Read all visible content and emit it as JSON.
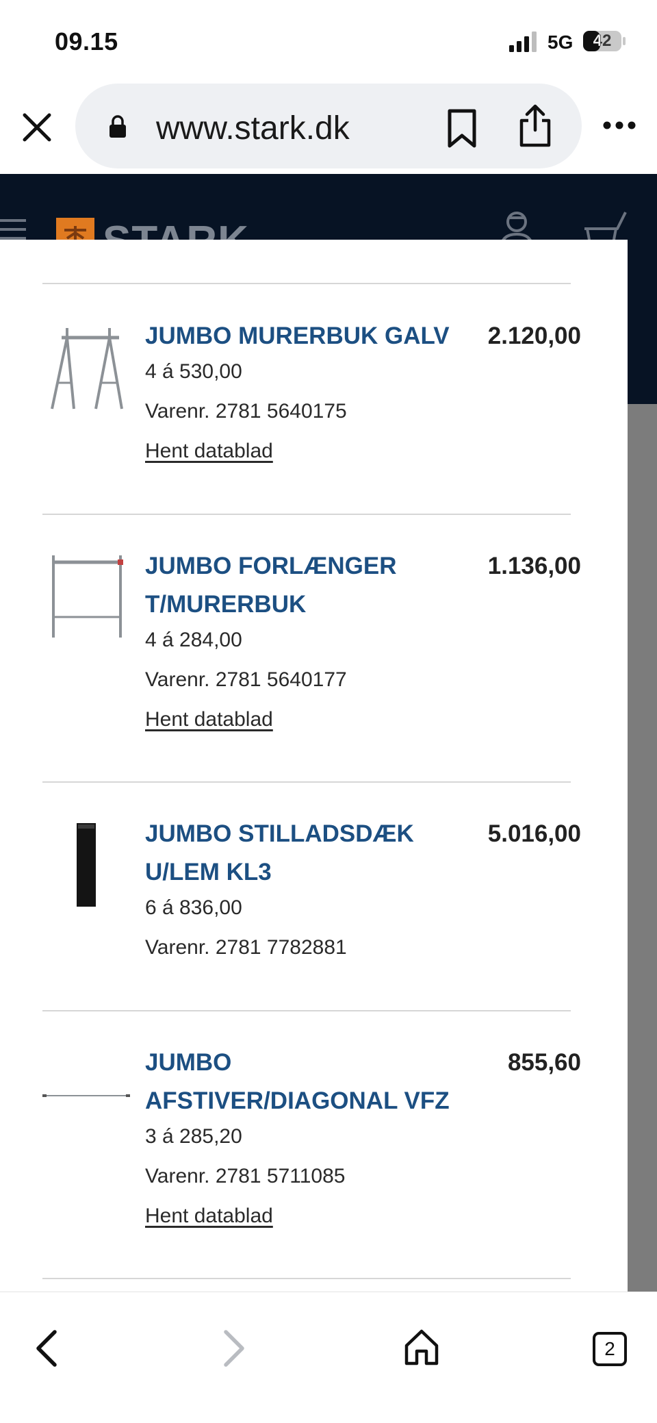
{
  "status_bar": {
    "time": "09.15",
    "network": "5G",
    "battery": "42"
  },
  "browser": {
    "url": "www.stark.dk",
    "tab_count": "2"
  },
  "site": {
    "logo_text": "STARK"
  },
  "items": [
    {
      "name": "JUMBO MURERBUK GALV",
      "price": "2.120,00",
      "quantity": "4 á 530,00",
      "item_number": "Varenr. 2781 5640175",
      "datasheet": "Hent datablad"
    },
    {
      "name": "JUMBO FORLÆNGER T/MURERBUK",
      "price": "1.136,00",
      "quantity": "4 á 284,00",
      "item_number": "Varenr. 2781 5640177",
      "datasheet": "Hent datablad"
    },
    {
      "name": "JUMBO STILLADSDÆK U/LEM KL3",
      "price": "5.016,00",
      "quantity": "6 á 836,00",
      "item_number": "Varenr. 2781 7782881"
    },
    {
      "name": "JUMBO AFSTIVER/DIAGONAL VFZ",
      "price": "855,60",
      "quantity": "3 á 285,20",
      "item_number": "Varenr. 2781 5711085",
      "datasheet": "Hent datablad"
    }
  ],
  "colors": {
    "header_bg": "#071324",
    "product_name": "#1c4f82",
    "logo_orange": "#e07a20"
  }
}
